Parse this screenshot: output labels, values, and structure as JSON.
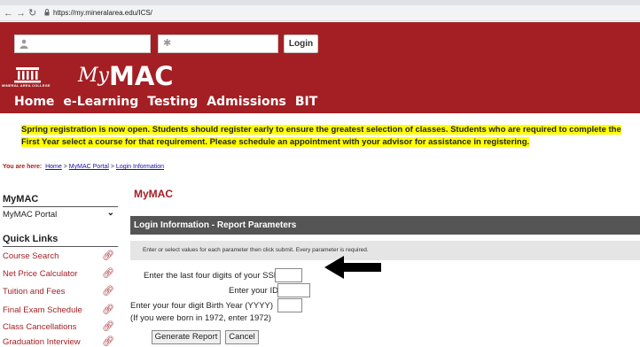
{
  "browser": {
    "back_icon": "back-arrow-icon",
    "forward_icon": "forward-arrow-icon",
    "reload_icon": "reload-icon",
    "url": "https://my.mineralarea.edu/ICS/"
  },
  "header": {
    "username_icon": "user-icon",
    "password_icon": "asterisk-icon",
    "login_label": "Login",
    "college_name": "MINERAL AREA COLLEGE",
    "logo_my": "My",
    "logo_mac": "MAC",
    "nav": [
      "Home",
      "e-Learning",
      "Testing",
      "Admissions",
      "BIT"
    ]
  },
  "announcement": "Spring registration is now open. Students should register early to ensure the greatest selection of classes. Students who are required to complete the First Year select a course for that requirement. Please schedule an appointment with your advisor for assistance in registering.",
  "breadcrumb": {
    "prefix": "You are here:",
    "items": [
      "Home",
      "MyMAC Portal",
      "Login Information"
    ],
    "sep": ">"
  },
  "sidebar": {
    "section_title": "MyMAC",
    "portal_item": "MyMAC Portal",
    "quick_links_title": "Quick Links",
    "links": [
      "Course Search",
      "Net Price Calculator",
      "Tuition and Fees",
      "Final Exam Schedule",
      "Class Cancellations",
      "Graduation Interview"
    ]
  },
  "main": {
    "title": "MyMAC",
    "panel_title": "Login Information - Report Parameters",
    "instructions": "Enter or select values for each parameter then click submit. Every parameter is required.",
    "ssn_label": "Enter the last four digits of your SSN",
    "id_label": "Enter your ID",
    "birth_label": "Enter your four digit Birth Year (YYYY)",
    "birth_hint": "(If you were born in 1972, enter 1972)",
    "generate_label": "Generate Report",
    "cancel_label": "Cancel"
  }
}
